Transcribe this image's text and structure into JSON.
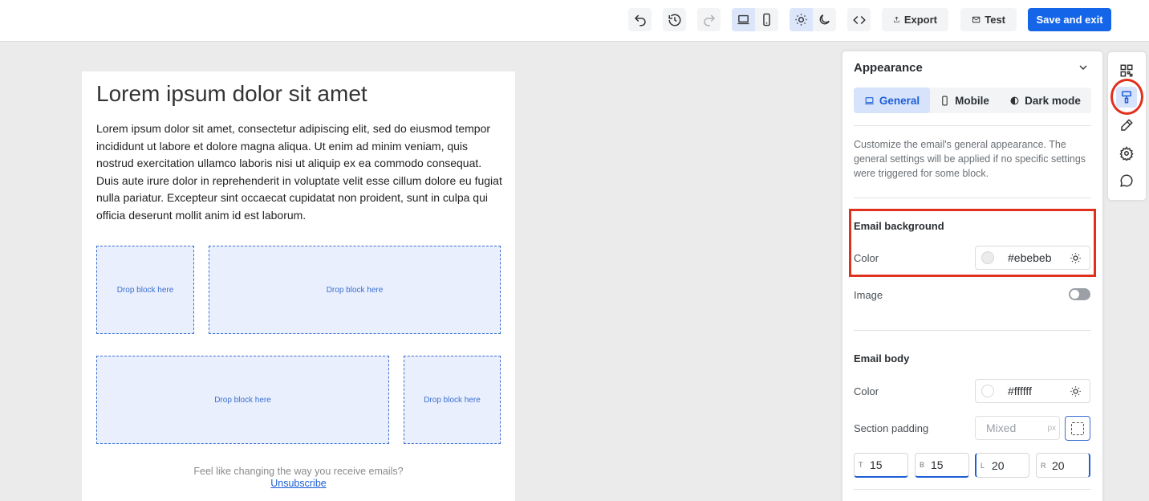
{
  "toolbar": {
    "export_label": "Export",
    "test_label": "Test",
    "save_label": "Save and exit"
  },
  "email": {
    "heading": "Lorem ipsum dolor sit amet",
    "body": "Lorem ipsum dolor sit amet, consectetur adipiscing elit, sed do eiusmod tempor incididunt ut labore et dolore magna aliqua. Ut enim ad minim veniam, quis nostrud exercitation ullamco laboris nisi ut aliquip ex ea commodo consequat. Duis aute irure dolor in reprehenderit in voluptate velit esse cillum dolore eu fugiat nulla pariatur. Excepteur sint occaecat cupidatat non proident, sunt in culpa qui officia deserunt mollit anim id est laborum.",
    "drop_label": "Drop block here",
    "footer_question": "Feel like changing the way you receive emails?",
    "unsubscribe": "Unsubscribe"
  },
  "panel": {
    "title": "Appearance",
    "tabs": [
      {
        "label": "General"
      },
      {
        "label": "Mobile"
      },
      {
        "label": "Dark mode"
      }
    ],
    "description": "Customize the email's general appearance. The general settings will be applied if no specific settings were triggered for some block.",
    "email_background": {
      "title": "Email background",
      "color_label": "Color",
      "color_value": "#ebebeb",
      "image_label": "Image"
    },
    "email_body": {
      "title": "Email body",
      "color_label": "Color",
      "color_value": "#ffffff",
      "padding_label": "Section padding",
      "padding_mixed": "Mixed",
      "padding_unit": "px",
      "padding": [
        {
          "key": "T",
          "value": "15"
        },
        {
          "key": "B",
          "value": "15"
        },
        {
          "key": "L",
          "value": "20"
        },
        {
          "key": "R",
          "value": "20"
        }
      ]
    }
  },
  "colors": {
    "accent": "#1565e8",
    "highlight": "#e0301e",
    "canvas": "#ebebeb"
  }
}
